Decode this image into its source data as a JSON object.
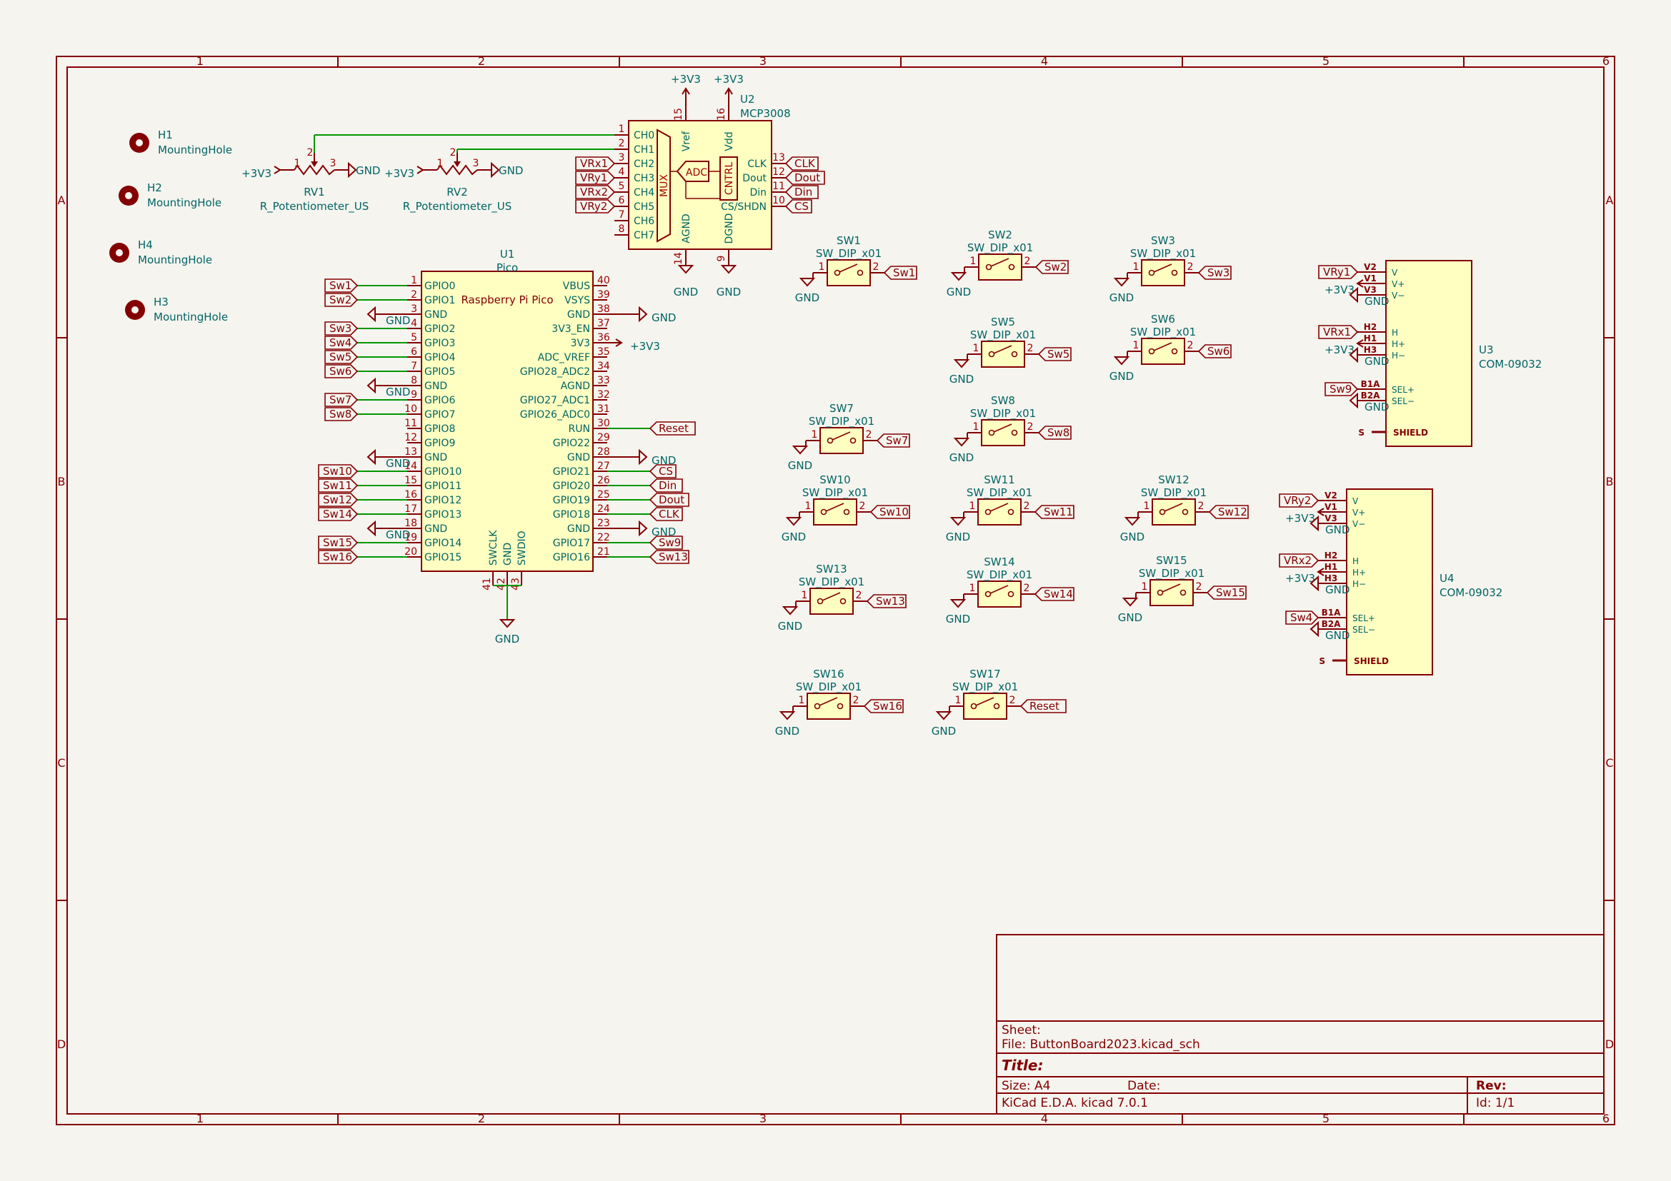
{
  "border": {
    "cols": [
      "1",
      "2",
      "3",
      "4",
      "5",
      "6"
    ],
    "rows": [
      "A",
      "B",
      "C",
      "D"
    ]
  },
  "colors": {
    "background": "#f5f4ef",
    "line": "#840000",
    "text": "#006464",
    "body": "#ffffc2",
    "wire": "#009600"
  },
  "mounting_holes": [
    {
      "ref": "H1",
      "value": "MountingHole"
    },
    {
      "ref": "H2",
      "value": "MountingHole"
    },
    {
      "ref": "H4",
      "value": "MountingHole"
    },
    {
      "ref": "H3",
      "value": "MountingHole"
    }
  ],
  "pots": [
    {
      "ref": "RV1",
      "value": "R_Potentiometer_US",
      "left": "+3V3",
      "right": "GND",
      "p1": "1",
      "p2": "2",
      "p3": "3"
    },
    {
      "ref": "RV2",
      "value": "R_Potentiometer_US",
      "left": "+3V3",
      "right": "GND",
      "p1": "1",
      "p2": "2",
      "p3": "3"
    }
  ],
  "adc": {
    "ref": "U2",
    "value": "MCP3008",
    "vref_power": "+3V3",
    "vdd_power": "+3V3",
    "gnd1": "GND",
    "gnd2": "GND",
    "top_pins": [
      {
        "num": "15",
        "name": "Vref"
      },
      {
        "num": "16",
        "name": "Vdd"
      }
    ],
    "bottom_pins": [
      {
        "num": "14",
        "name": "AGND"
      },
      {
        "num": "9",
        "name": "DGND"
      }
    ],
    "left_pins": [
      {
        "num": "1",
        "name": "CH0",
        "label": ""
      },
      {
        "num": "2",
        "name": "CH1",
        "label": ""
      },
      {
        "num": "3",
        "name": "CH2",
        "label": "VRx1"
      },
      {
        "num": "4",
        "name": "CH3",
        "label": "VRy1"
      },
      {
        "num": "5",
        "name": "CH4",
        "label": "VRx2"
      },
      {
        "num": "6",
        "name": "CH5",
        "label": "VRy2"
      },
      {
        "num": "7",
        "name": "CH6",
        "label": ""
      },
      {
        "num": "8",
        "name": "CH7",
        "label": ""
      }
    ],
    "right_pins": [
      {
        "num": "13",
        "name": "CLK",
        "label": "CLK"
      },
      {
        "num": "12",
        "name": "Dout",
        "label": "Dout"
      },
      {
        "num": "11",
        "name": "Din",
        "label": "Din"
      },
      {
        "num": "10",
        "name": "CS/SHDN",
        "label": "CS"
      }
    ],
    "mux": "MUX",
    "adc_block": "ADC",
    "cntrl": "CNTRL"
  },
  "pico": {
    "ref": "U1",
    "value": "Pico",
    "title": "Raspberry Pi Pico",
    "bottom_gnd": "GND",
    "left_pins": [
      {
        "num": "1",
        "name": "GPIO0",
        "label": "Sw1"
      },
      {
        "num": "2",
        "name": "GPIO1",
        "label": "Sw2"
      },
      {
        "num": "3",
        "name": "GND",
        "label": "GND"
      },
      {
        "num": "4",
        "name": "GPIO2",
        "label": "Sw3"
      },
      {
        "num": "5",
        "name": "GPIO3",
        "label": "Sw4"
      },
      {
        "num": "6",
        "name": "GPIO4",
        "label": "Sw5"
      },
      {
        "num": "7",
        "name": "GPIO5",
        "label": "Sw6"
      },
      {
        "num": "8",
        "name": "GND",
        "label": "GND"
      },
      {
        "num": "9",
        "name": "GPIO6",
        "label": "Sw7"
      },
      {
        "num": "10",
        "name": "GPIO7",
        "label": "Sw8"
      },
      {
        "num": "11",
        "name": "GPIO8",
        "label": ""
      },
      {
        "num": "12",
        "name": "GPIO9",
        "label": ""
      },
      {
        "num": "13",
        "name": "GND",
        "label": "GND"
      },
      {
        "num": "14",
        "name": "GPIO10",
        "label": "Sw10"
      },
      {
        "num": "15",
        "name": "GPIO11",
        "label": "Sw11"
      },
      {
        "num": "16",
        "name": "GPIO12",
        "label": "Sw12"
      },
      {
        "num": "17",
        "name": "GPIO13",
        "label": "Sw14"
      },
      {
        "num": "18",
        "name": "GND",
        "label": "GND"
      },
      {
        "num": "19",
        "name": "GPIO14",
        "label": "Sw15"
      },
      {
        "num": "20",
        "name": "GPIO15",
        "label": "Sw16"
      }
    ],
    "right_pins": [
      {
        "num": "40",
        "name": "VBUS",
        "label": ""
      },
      {
        "num": "39",
        "name": "VSYS",
        "label": ""
      },
      {
        "num": "38",
        "name": "GND",
        "label": "GND"
      },
      {
        "num": "37",
        "name": "3V3_EN",
        "label": ""
      },
      {
        "num": "36",
        "name": "3V3",
        "label": "+3V3"
      },
      {
        "num": "35",
        "name": "ADC_VREF",
        "label": ""
      },
      {
        "num": "34",
        "name": "GPIO28_ADC2",
        "label": ""
      },
      {
        "num": "33",
        "name": "AGND",
        "label": ""
      },
      {
        "num": "32",
        "name": "GPIO27_ADC1",
        "label": ""
      },
      {
        "num": "31",
        "name": "GPIO26_ADC0",
        "label": ""
      },
      {
        "num": "30",
        "name": "RUN",
        "label": "Reset"
      },
      {
        "num": "29",
        "name": "GPIO22",
        "label": ""
      },
      {
        "num": "28",
        "name": "GND",
        "label": "GND"
      },
      {
        "num": "27",
        "name": "GPIO21",
        "label": "CS"
      },
      {
        "num": "26",
        "name": "GPIO20",
        "label": "Din"
      },
      {
        "num": "25",
        "name": "GPIO19",
        "label": "Dout"
      },
      {
        "num": "24",
        "name": "GPIO18",
        "label": "CLK"
      },
      {
        "num": "23",
        "name": "GND",
        "label": "GND"
      },
      {
        "num": "22",
        "name": "GPIO17",
        "label": "Sw9"
      },
      {
        "num": "21",
        "name": "GPIO16",
        "label": "Sw13"
      }
    ],
    "bottom_pins": [
      {
        "num": "41",
        "name": "SWCLK"
      },
      {
        "num": "42",
        "name": "GND"
      },
      {
        "num": "43",
        "name": "SWDIO"
      }
    ]
  },
  "switches": [
    {
      "ref": "SW1",
      "value": "SW_DIP_x01",
      "label": "Sw1",
      "gnd": "GND",
      "p1": "1",
      "p2": "2"
    },
    {
      "ref": "SW2",
      "value": "SW_DIP_x01",
      "label": "Sw2",
      "gnd": "GND",
      "p1": "1",
      "p2": "2"
    },
    {
      "ref": "SW3",
      "value": "SW_DIP_x01",
      "label": "Sw3",
      "gnd": "GND",
      "p1": "1",
      "p2": "2"
    },
    {
      "ref": "SW5",
      "value": "SW_DIP_x01",
      "label": "Sw5",
      "gnd": "GND",
      "p1": "1",
      "p2": "2"
    },
    {
      "ref": "SW6",
      "value": "SW_DIP_x01",
      "label": "Sw6",
      "gnd": "GND",
      "p1": "1",
      "p2": "2"
    },
    {
      "ref": "SW7",
      "value": "SW_DIP_x01",
      "label": "Sw7",
      "gnd": "GND",
      "p1": "1",
      "p2": "2"
    },
    {
      "ref": "SW8",
      "value": "SW_DIP_x01",
      "label": "Sw8",
      "gnd": "GND",
      "p1": "1",
      "p2": "2"
    },
    {
      "ref": "SW10",
      "value": "SW_DIP_x01",
      "label": "Sw10",
      "gnd": "GND",
      "p1": "1",
      "p2": "2"
    },
    {
      "ref": "SW11",
      "value": "SW_DIP_x01",
      "label": "Sw11",
      "gnd": "GND",
      "p1": "1",
      "p2": "2"
    },
    {
      "ref": "SW12",
      "value": "SW_DIP_x01",
      "label": "Sw12",
      "gnd": "GND",
      "p1": "1",
      "p2": "2"
    },
    {
      "ref": "SW13",
      "value": "SW_DIP_x01",
      "label": "Sw13",
      "gnd": "GND",
      "p1": "1",
      "p2": "2"
    },
    {
      "ref": "SW14",
      "value": "SW_DIP_x01",
      "label": "Sw14",
      "gnd": "GND",
      "p1": "1",
      "p2": "2"
    },
    {
      "ref": "SW15",
      "value": "SW_DIP_x01",
      "label": "Sw15",
      "gnd": "GND",
      "p1": "1",
      "p2": "2"
    },
    {
      "ref": "SW16",
      "value": "SW_DIP_x01",
      "label": "Sw16",
      "gnd": "GND",
      "p1": "1",
      "p2": "2"
    },
    {
      "ref": "SW17",
      "value": "SW_DIP_x01",
      "label": "Reset",
      "gnd": "GND",
      "p1": "1",
      "p2": "2"
    }
  ],
  "joysticks": [
    {
      "ref": "U3",
      "value": "COM-09032",
      "pins": [
        {
          "num": "V2",
          "name": "V",
          "label": "VRy1"
        },
        {
          "num": "V1",
          "name": "V+",
          "label": "+3V3"
        },
        {
          "num": "V3",
          "name": "V−",
          "label": "GND"
        },
        {
          "num": "H2",
          "name": "H",
          "label": "VRx1"
        },
        {
          "num": "H1",
          "name": "H+",
          "label": "+3V3"
        },
        {
          "num": "H3",
          "name": "H−",
          "label": "GND"
        },
        {
          "num": "B1A",
          "name": "SEL+",
          "label": "Sw9"
        },
        {
          "num": "B2A",
          "name": "SEL−",
          "label": "GND"
        }
      ],
      "shield_num": "S",
      "shield": "SHIELD"
    },
    {
      "ref": "U4",
      "value": "COM-09032",
      "pins": [
        {
          "num": "V2",
          "name": "V",
          "label": "VRy2"
        },
        {
          "num": "V1",
          "name": "V+",
          "label": "+3V3"
        },
        {
          "num": "V3",
          "name": "V−",
          "label": "GND"
        },
        {
          "num": "H2",
          "name": "H",
          "label": "VRx2"
        },
        {
          "num": "H1",
          "name": "H+",
          "label": "+3V3"
        },
        {
          "num": "H3",
          "name": "H−",
          "label": "GND"
        },
        {
          "num": "B1A",
          "name": "SEL+",
          "label": "Sw4"
        },
        {
          "num": "B2A",
          "name": "SEL−",
          "label": "GND"
        }
      ],
      "shield_num": "S",
      "shield": "SHIELD"
    }
  ],
  "title_block": {
    "sheet": "Sheet:",
    "file": "File: ButtonBoard2023.kicad_sch",
    "title": "Title:",
    "size": "Size: A4",
    "date": "Date:",
    "rev": "Rev:",
    "tool": "KiCad E.D.A.  kicad 7.0.1",
    "id": "Id: 1/1"
  }
}
